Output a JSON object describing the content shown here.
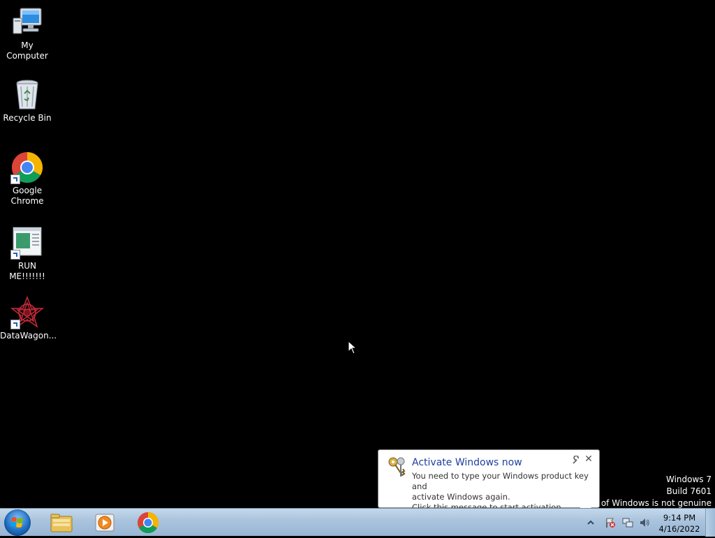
{
  "desktop": {
    "icons": [
      {
        "label": "My Computer"
      },
      {
        "label": "Recycle Bin"
      },
      {
        "label": "Google\nChrome"
      },
      {
        "label": "RUN ME!!!!!!!"
      },
      {
        "label": "DataWagon..."
      }
    ]
  },
  "watermark": {
    "line1": "Windows 7",
    "line2": "Build 7601",
    "line3": "py of Windows is not genuine"
  },
  "balloon": {
    "title": "Activate Windows now",
    "line1": "You need to type your Windows product key and",
    "line2": "activate Windows again.",
    "line3": "Click this message to start activation."
  },
  "taskbar": {
    "pinned": [
      "windows-explorer",
      "windows-media-player",
      "google-chrome"
    ],
    "clock": {
      "time": "9:14 PM",
      "date": "4/16/2022"
    }
  },
  "colors": {
    "desktop_bg": "#000000",
    "taskbar": "#a9c3dd",
    "balloon_title": "#1e3f9f"
  }
}
